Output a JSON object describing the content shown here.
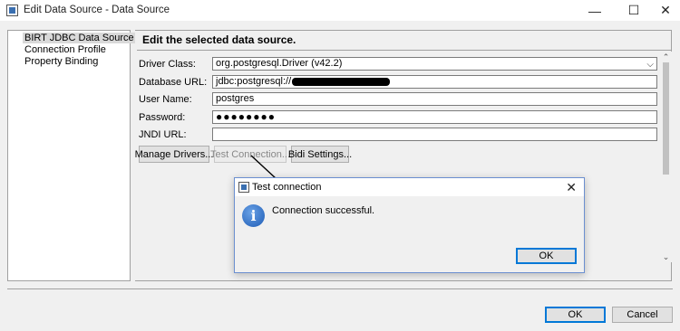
{
  "window": {
    "title": "Edit Data Source - Data Source",
    "minimize_glyph": "—",
    "maximize_glyph": "☐",
    "close_glyph": "✕"
  },
  "tree": {
    "items": [
      {
        "label": "BIRT JDBC Data Source",
        "selected": true
      },
      {
        "label": "Connection Profile",
        "selected": false
      },
      {
        "label": "Property Binding",
        "selected": false
      }
    ]
  },
  "main": {
    "section_title": "Edit the selected data source.",
    "fields": {
      "driver_class": {
        "label": "Driver Class:",
        "value": "org.postgresql.Driver (v42.2)"
      },
      "database_url": {
        "label": "Database URL:",
        "value": "jdbc:postgresql://"
      },
      "user_name": {
        "label": "User Name:",
        "value": "postgres"
      },
      "password": {
        "label": "Password:",
        "value": "●●●●●●●●"
      },
      "jndi_url": {
        "label": "JNDI URL:",
        "value": ""
      }
    },
    "buttons": {
      "manage_drivers": "Manage Drivers...",
      "test_connection": "Test Connection...",
      "bidi_settings": "Bidi Settings..."
    }
  },
  "footer": {
    "ok": "OK",
    "cancel": "Cancel"
  },
  "dialog": {
    "title": "Test connection",
    "message": "Connection successful.",
    "ok": "OK",
    "close_glyph": "✕",
    "icon": "info-icon"
  },
  "colors": {
    "accent": "#0078d7",
    "info_blue": "#1d5bb5"
  }
}
